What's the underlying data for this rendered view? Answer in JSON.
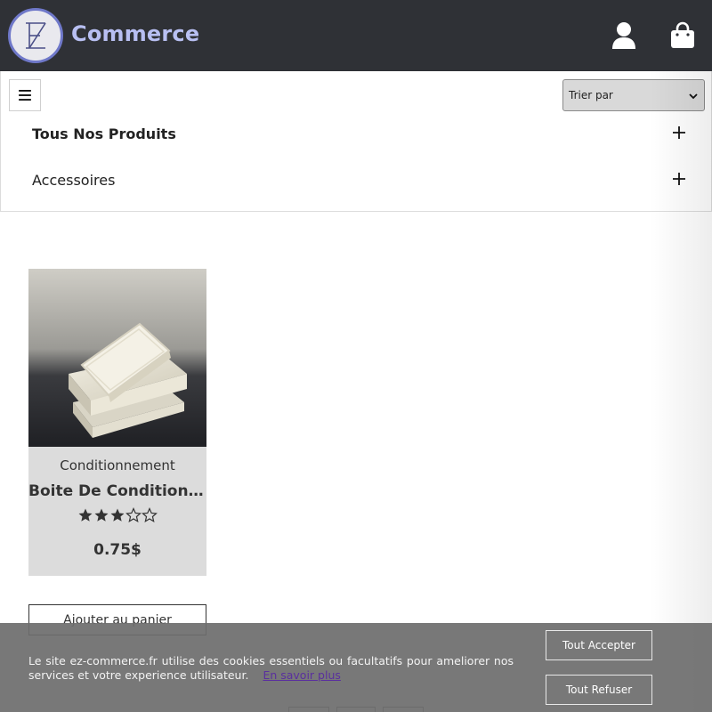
{
  "header": {
    "brand": "Commerce",
    "logo_icon": "ez-logo-icon",
    "user_icon": "user-icon",
    "bag_icon": "shopping-bag-icon",
    "bg_color": "#2f3136",
    "brand_color": "#b8bff2"
  },
  "toolbar": {
    "menu_icon": "hamburger-icon",
    "sort_label": "Trier par"
  },
  "categories": [
    {
      "label": "Tous Nos Produits",
      "icon": "plus-icon",
      "bold": true
    },
    {
      "label": "Accessoires",
      "icon": "plus-icon",
      "bold": false
    }
  ],
  "product": {
    "category": "Conditionnement",
    "title": "Boite De Conditionnement",
    "rating": 3,
    "rating_max": 5,
    "price": "0.75$",
    "add_to_cart": "Ajouter au panier"
  },
  "cookie": {
    "text": "Le site ez-commerce.fr utilise des cookies essentiels ou facultatifs pour ameliorer nos services et votre experience utilisateur.",
    "link": "En savoir plus",
    "accept": "Tout Accepter",
    "refuse": "Tout Refuser"
  }
}
